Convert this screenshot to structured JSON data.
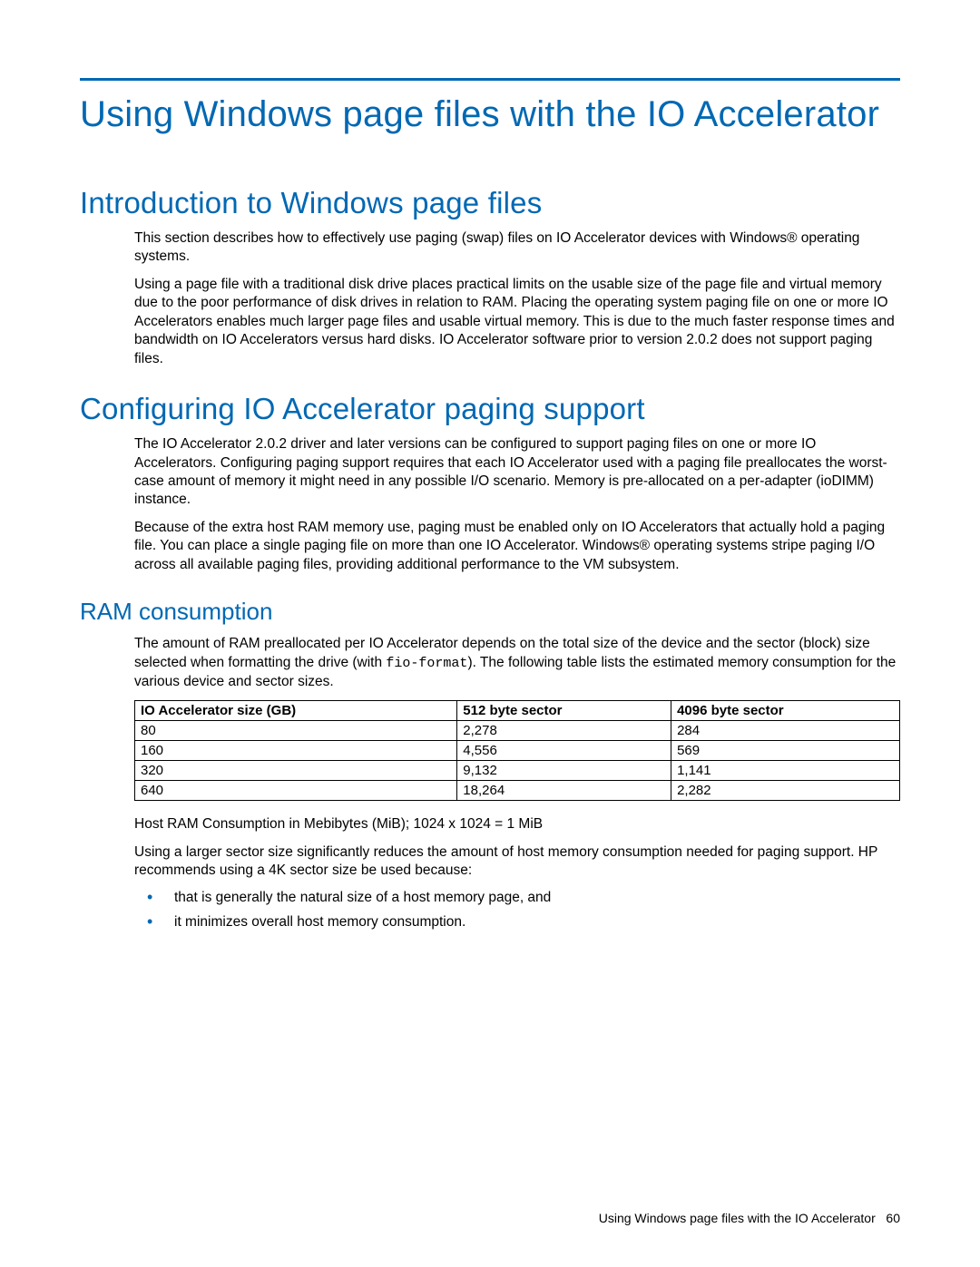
{
  "heading1": "Using Windows page files with the IO Accelerator",
  "section_intro": {
    "title": "Introduction to Windows page files",
    "p1": "This section describes how to effectively use paging (swap) files on IO Accelerator devices with Windows® operating systems.",
    "p2": "Using a page file with a traditional disk drive places practical limits on the usable size of the page file and virtual memory due to the poor performance of disk drives in relation to RAM. Placing the operating system paging file on one or more IO Accelerators enables much larger page files and usable virtual memory. This is due to the much faster response times and bandwidth on IO Accelerators versus hard disks. IO Accelerator software prior to version 2.0.2 does not support paging files."
  },
  "section_config": {
    "title": "Configuring IO Accelerator paging support",
    "p1": "The IO Accelerator 2.0.2 driver and later versions can be configured to support paging files on one or more IO Accelerators. Configuring paging support requires that each IO Accelerator used with a paging file preallocates the worst-case amount of memory it might need in any possible I/O scenario. Memory is pre-allocated on a per-adapter (ioDIMM) instance.",
    "p2": "Because of the extra host RAM memory use, paging must be enabled only on IO Accelerators that actually hold a paging file. You can place a single paging file on more than one IO Accelerator. Windows® operating systems stripe paging I/O across all available paging files, providing additional performance to the VM subsystem."
  },
  "section_ram": {
    "title": "RAM consumption",
    "p1_a": "The amount of RAM preallocated per IO Accelerator depends on the total size of the device and the sector (block) size selected when formatting the drive (with ",
    "p1_code": "fio-format",
    "p1_b": "). The following table lists the estimated memory consumption for the various device and sector sizes.",
    "table": {
      "headers": [
        "IO Accelerator size (GB)",
        "512 byte sector",
        "4096 byte sector"
      ],
      "rows": [
        [
          "80",
          "2,278",
          "284"
        ],
        [
          "160",
          "4,556",
          "569"
        ],
        [
          "320",
          "9,132",
          "1,141"
        ],
        [
          "640",
          "18,264",
          "2,282"
        ]
      ]
    },
    "p2": "Host RAM Consumption in Mebibytes (MiB); 1024 x 1024 = 1 MiB",
    "p3": "Using a larger sector size significantly reduces the amount of host memory consumption needed for paging support. HP recommends using a 4K sector size be used because:",
    "bullets": [
      "that is generally the natural size of a host memory page, and",
      "it minimizes overall host memory consumption."
    ]
  },
  "chart_data": {
    "type": "table",
    "title": "Estimated host RAM consumption (MiB) by IO Accelerator size and sector size",
    "columns": [
      "IO Accelerator size (GB)",
      "512 byte sector",
      "4096 byte sector"
    ],
    "rows": [
      {
        "size_gb": 80,
        "sector_512": 2278,
        "sector_4096": 284
      },
      {
        "size_gb": 160,
        "sector_512": 4556,
        "sector_4096": 569
      },
      {
        "size_gb": 320,
        "sector_512": 9132,
        "sector_4096": 1141
      },
      {
        "size_gb": 640,
        "sector_512": 18264,
        "sector_4096": 2282
      }
    ],
    "unit": "MiB"
  },
  "footer": {
    "text": "Using Windows page files with the IO Accelerator",
    "page": "60"
  }
}
